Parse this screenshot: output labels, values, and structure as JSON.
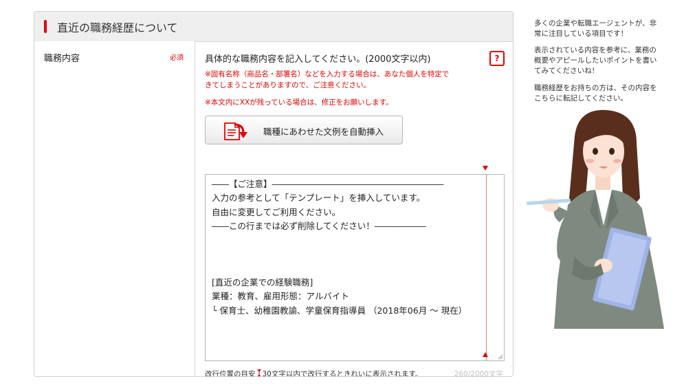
{
  "section": {
    "title": "直近の職務経歴について"
  },
  "field": {
    "label": "職務内容",
    "required": "必須",
    "instruction": "具体的な職務内容を記入してください。(2000文字以内)",
    "help_icon_text": "?",
    "warning_1": "※固有名称（商品名・部署名）などを入力する場合は、あなた個人を特定で\nきてしまうことがありますので、ご注意ください。",
    "warning_2": "※本文内にXXが残っている場合は、修正をお願いします。",
    "insert_button_label": "職種にあわせた文例を自動挿入",
    "textarea_value": "――【ご注意】――――――――――――――――――――\n入力の参考として「テンプレート」を挿入しています。\n自由に変更してご利用ください。\n――この行までは必ず削除してください！――――――\n\n\n\n[直近の企業での経験職務]\n業種：教育、雇用形態：アルバイト\n└ 保育士、幼稚園教諭、学童保育指導員 （2018年06月 ～ 現在）",
    "hint_before": "改行位置の目安",
    "hint_after": "30文字以内で改行するときれいに表示されます。",
    "char_count": "260/2000文字"
  },
  "side_notes": [
    "多くの企業や転職エージェントが、非\n常に注目している項目です！",
    "表示されている内容を参考に、業務の\n概要やアピールしたいポイントを書い\nてみてくださいね！",
    "職務経歴をお持ちの方は、その内容を\nこちらに転記してください。"
  ],
  "icons": {
    "help": "question-icon",
    "insert": "document-arrow-icon",
    "guide": "line-guide-marker-icon",
    "resize": "resize-grip-icon"
  },
  "colors": {
    "accent": "#e30000",
    "header_bg": "#efefef",
    "border": "#cfcfcf",
    "muted": "#c0c0c0"
  }
}
